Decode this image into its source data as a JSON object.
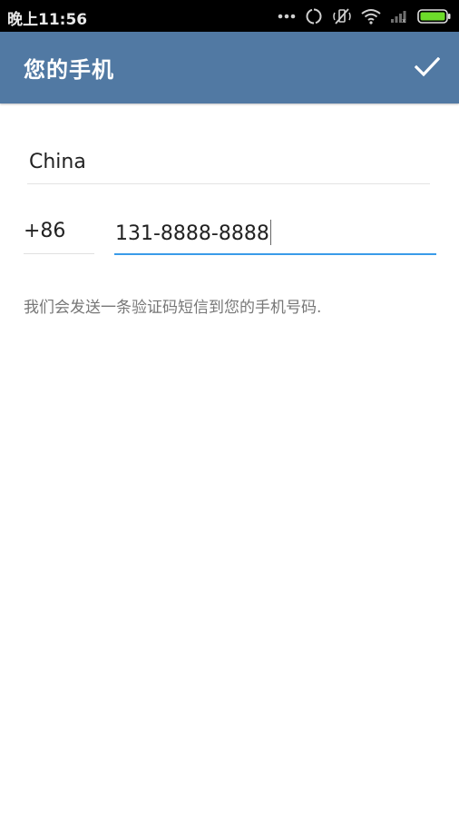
{
  "status_bar": {
    "time": "晚上11:56",
    "icons": [
      "more-dots-icon",
      "sync-icon",
      "silent-icon",
      "wifi-icon",
      "signal-icon",
      "battery-icon"
    ],
    "battery_color": "#6ddc2b"
  },
  "app_bar": {
    "title": "您的手机",
    "done_icon": "check-icon",
    "background": "#5179a3"
  },
  "form": {
    "country": "China",
    "country_code": "+86",
    "phone_number": "131-8888-8888",
    "accent_color": "#3a9be9"
  },
  "hint": "我们会发送一条验证码短信到您的手机号码."
}
